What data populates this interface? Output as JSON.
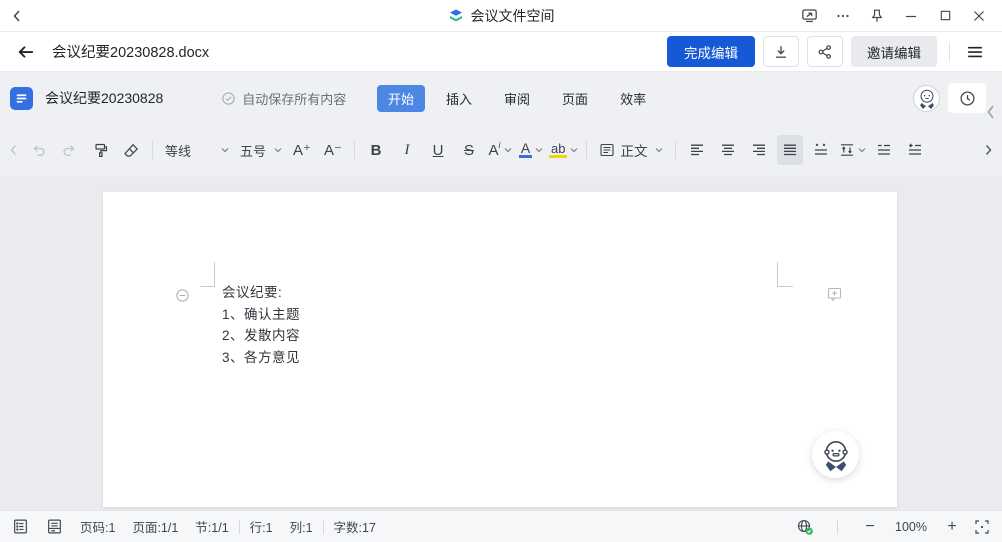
{
  "titlebar": {
    "app_title": "会议文件空间"
  },
  "doc_header": {
    "filename": "会议纪要20230828.docx",
    "finish_label": "完成编辑",
    "invite_label": "邀请编辑"
  },
  "ribbon": {
    "doc_title": "会议纪要20230828",
    "autosave_label": "自动保存所有内容",
    "tabs": [
      {
        "label": "开始",
        "active": true
      },
      {
        "label": "插入",
        "active": false
      },
      {
        "label": "审阅",
        "active": false
      },
      {
        "label": "页面",
        "active": false
      },
      {
        "label": "效率",
        "active": false
      }
    ]
  },
  "toolbar": {
    "font_name": "等线",
    "font_size": "五号",
    "font_increase": "A⁺",
    "font_decrease": "A⁻",
    "bold": "B",
    "italic": "I",
    "underline": "U",
    "strikethrough": "S",
    "effect_letter": "A",
    "effect_sup": "i",
    "font_color_letter": "A",
    "highlight_letters": "ab",
    "style_name": "正文"
  },
  "document": {
    "lines": [
      "会议纪要:",
      "1、确认主题",
      "2、发散内容",
      "3、各方意见"
    ]
  },
  "statusbar": {
    "page_number": "页码:1",
    "page_count": "页面:1/1",
    "section": "节:1/1",
    "line": "行:1",
    "column": "列:1",
    "word_count": "字数:17",
    "zoom_out": "−",
    "zoom_level": "100%",
    "zoom_in": "+"
  },
  "colors": {
    "primary_button_blue": "#1659d6",
    "active_tab_blue": "#4b87e3",
    "doc_icon_blue": "#3470e4",
    "font_color_bar": "#3a6fd8",
    "highlight_bar": "#f0d40c",
    "logo_blue": "#2f6be4",
    "logo_teal": "#27b791",
    "autosave_check_green": "#2eb45c"
  }
}
